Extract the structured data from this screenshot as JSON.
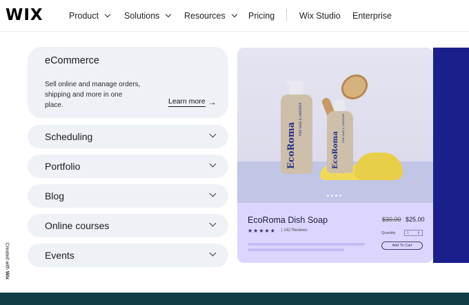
{
  "nav": {
    "logo": "WIX",
    "items": [
      {
        "label": "Product",
        "dropdown": true
      },
      {
        "label": "Solutions",
        "dropdown": true
      },
      {
        "label": "Resources",
        "dropdown": true
      },
      {
        "label": "Pricing",
        "dropdown": false
      },
      {
        "label": "Wix Studio",
        "dropdown": false
      },
      {
        "label": "Enterprise",
        "dropdown": false
      }
    ]
  },
  "solutions": {
    "open": {
      "title": "eCommerce",
      "description": "Sell online and manage orders, shipping and more in one place.",
      "link": "Learn more",
      "link_icon": "arrow-right-icon"
    },
    "collapsed": [
      "Scheduling",
      "Portfolio",
      "Blog",
      "Online courses",
      "Events"
    ]
  },
  "product_card": {
    "brand": "EcoRoma",
    "bottle_text": "PINE SAGE & LAVENDER",
    "name": "EcoRoma Dish Soap",
    "stars": "★★★★★",
    "reviews": "| 142 Reviews",
    "old_price": "$30.00",
    "price": "$25.00",
    "quantity_label": "Quantity",
    "quantity_value": "1",
    "add_to_cart": "Add To Cart"
  },
  "side_tag": {
    "prefix": "Created with",
    "brand": "Wix"
  },
  "colors": {
    "card_bg": "#eef1f6",
    "product_info_bg": "#dcd6ff",
    "accent_blue": "#1a1f8c",
    "footer": "#113d48"
  }
}
